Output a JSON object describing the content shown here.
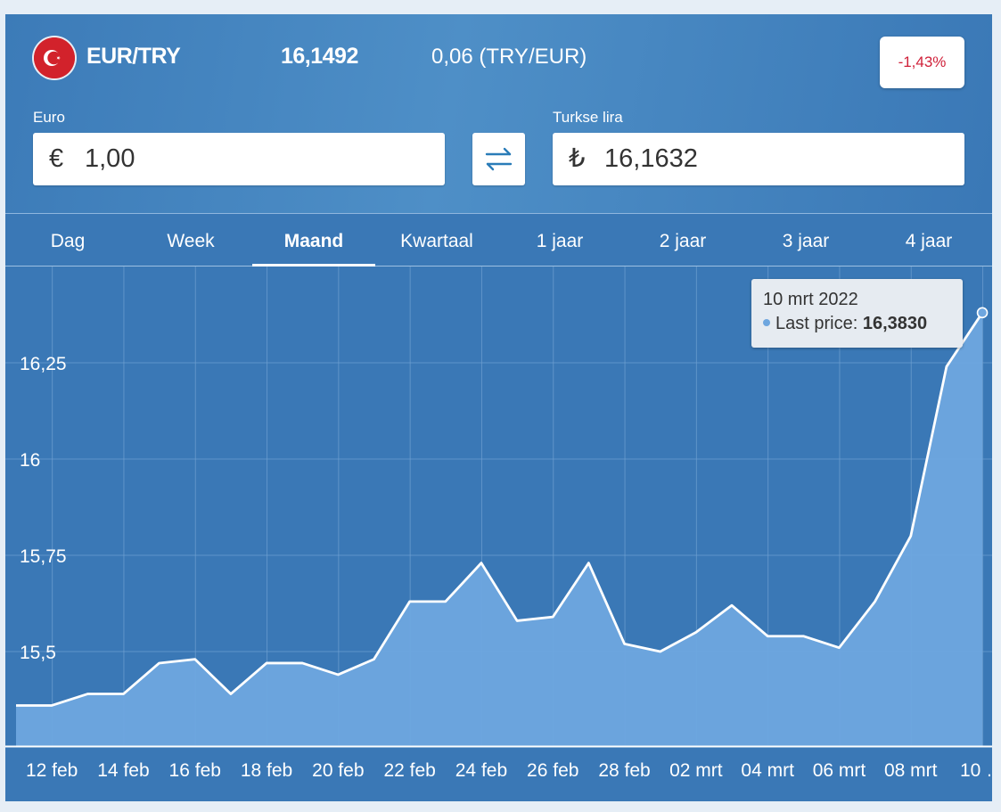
{
  "header": {
    "pair": "EUR/TRY",
    "rate": "16,1492",
    "inverse": "0,06 (TRY/EUR)",
    "change": "-1,43%",
    "flag_icon": "turkey-flag-icon"
  },
  "converter": {
    "from_label": "Euro",
    "from_symbol": "€",
    "from_value": "1,00",
    "to_label": "Turkse lira",
    "to_symbol": "₺",
    "to_value": "16,1632",
    "swap_icon": "swap-arrows-icon"
  },
  "tabs": [
    {
      "label": "Dag"
    },
    {
      "label": "Week"
    },
    {
      "label": "Maand",
      "active": true
    },
    {
      "label": "Kwartaal"
    },
    {
      "label": "1 jaar"
    },
    {
      "label": "2 jaar"
    },
    {
      "label": "3 jaar"
    },
    {
      "label": "4 jaar"
    }
  ],
  "tooltip": {
    "date": "10 mrt 2022",
    "label": "Last price:",
    "value": "16,3830"
  },
  "colors": {
    "background": "#3a78b6",
    "area": "#6ea6df",
    "line": "#ffffff",
    "negative": "#d0213a"
  },
  "chart_data": {
    "type": "area",
    "x": [
      "11 feb",
      "12 feb",
      "13 feb",
      "14 feb",
      "15 feb",
      "16 feb",
      "17 feb",
      "18 feb",
      "19 feb",
      "20 feb",
      "21 feb",
      "22 feb",
      "23 feb",
      "24 feb",
      "25 feb",
      "26 feb",
      "27 feb",
      "28 feb",
      "01 mrt",
      "02 mrt",
      "03 mrt",
      "04 mrt",
      "05 mrt",
      "06 mrt",
      "07 mrt",
      "08 mrt",
      "09 mrt",
      "10 mrt"
    ],
    "values": [
      15.36,
      15.36,
      15.39,
      15.39,
      15.47,
      15.48,
      15.39,
      15.47,
      15.47,
      15.44,
      15.48,
      15.63,
      15.63,
      15.73,
      15.58,
      15.59,
      15.73,
      15.52,
      15.5,
      15.55,
      15.62,
      15.54,
      15.54,
      15.51,
      15.63,
      15.8,
      16.24,
      16.38
    ],
    "y_ticks": [
      {
        "value": 15.5,
        "label": "15,5"
      },
      {
        "value": 15.75,
        "label": "15,75"
      },
      {
        "value": 16,
        "label": "16"
      },
      {
        "value": 16.25,
        "label": "16,25"
      }
    ],
    "x_tick_labels": [
      "12 feb",
      "14 feb",
      "16 feb",
      "18 feb",
      "20 feb",
      "22 feb",
      "24 feb",
      "26 feb",
      "28 feb",
      "02 mrt",
      "04 mrt",
      "06 mrt",
      "08 mrt",
      "10 …"
    ],
    "series": [
      {
        "name": "Last price"
      }
    ],
    "grid": true
  }
}
